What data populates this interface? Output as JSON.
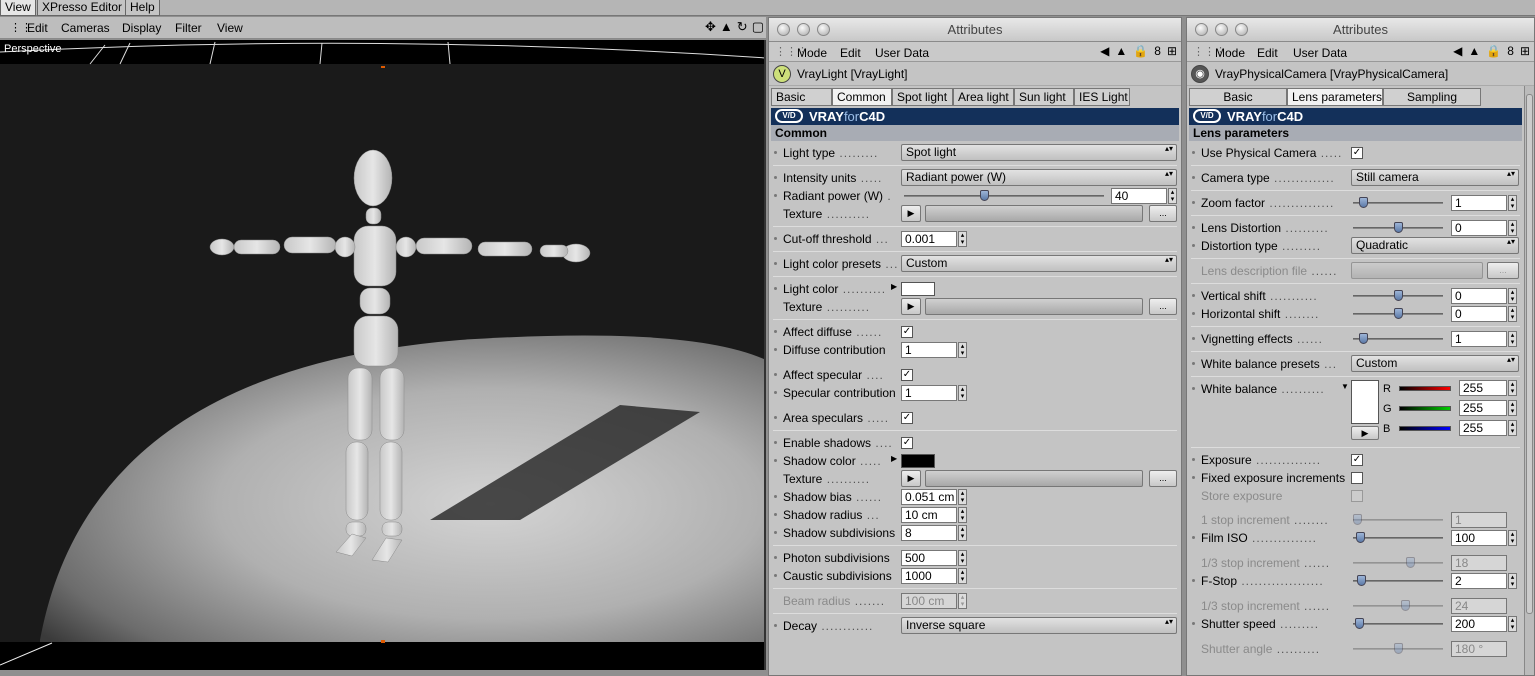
{
  "top_tabs": [
    "View",
    "XPresso Editor",
    "Help"
  ],
  "viewport": {
    "menu": [
      "Edit",
      "Cameras",
      "Display",
      "Filter",
      "View"
    ],
    "label": "Perspective",
    "icons": [
      "move-icon",
      "rotate-icon",
      "zoom-icon",
      "maximize-icon"
    ]
  },
  "panel1": {
    "title": "Attributes",
    "menu": [
      "Mode",
      "Edit",
      "User Data"
    ],
    "object": "VrayLight [VrayLight]",
    "tabs": [
      "Basic",
      "Common",
      "Spot light",
      "Area light",
      "Sun light",
      "IES Light"
    ],
    "active_tab": "Common",
    "brand_a": "VRAY",
    "brand_b": "for",
    "brand_c": "C4D",
    "section": "Common",
    "fields": {
      "light_type": {
        "label": "Light type",
        "value": "Spot light"
      },
      "intensity_units": {
        "label": "Intensity units",
        "value": "Radiant power (W)"
      },
      "radiant_power": {
        "label": "Radiant power (W)",
        "value": "40"
      },
      "texture1": {
        "label": "Texture"
      },
      "cutoff": {
        "label": "Cut-off threshold",
        "value": "0.001"
      },
      "color_presets": {
        "label": "Light color presets",
        "value": "Custom"
      },
      "light_color": {
        "label": "Light color"
      },
      "texture2": {
        "label": "Texture"
      },
      "affect_diffuse": {
        "label": "Affect diffuse"
      },
      "diffuse_contrib": {
        "label": "Diffuse contribution",
        "value": "1"
      },
      "affect_specular": {
        "label": "Affect specular"
      },
      "specular_contrib": {
        "label": "Specular contribution",
        "value": "1"
      },
      "area_speculars": {
        "label": "Area speculars"
      },
      "enable_shadows": {
        "label": "Enable shadows"
      },
      "shadow_color": {
        "label": "Shadow color"
      },
      "texture3": {
        "label": "Texture"
      },
      "shadow_bias": {
        "label": "Shadow bias",
        "value": "0.051 cm"
      },
      "shadow_radius": {
        "label": "Shadow radius",
        "value": "10 cm"
      },
      "shadow_subdiv": {
        "label": "Shadow subdivisions",
        "value": "8"
      },
      "photon_subdiv": {
        "label": "Photon subdivisions",
        "value": "500"
      },
      "caustic_subdiv": {
        "label": "Caustic subdivisions",
        "value": "1000"
      },
      "beam_radius": {
        "label": "Beam radius",
        "value": "100 cm"
      },
      "decay": {
        "label": "Decay",
        "value": "Inverse square"
      }
    },
    "more": "..."
  },
  "panel2": {
    "title": "Attributes",
    "menu": [
      "Mode",
      "Edit",
      "User Data"
    ],
    "object": "VrayPhysicalCamera [VrayPhysicalCamera]",
    "tabs": [
      "Basic",
      "Lens parameters",
      "Sampling"
    ],
    "active_tab": "Lens parameters",
    "section": "Lens parameters",
    "fields": {
      "use_physical": {
        "label": "Use Physical Camera"
      },
      "camera_type": {
        "label": "Camera type",
        "value": "Still camera"
      },
      "zoom_factor": {
        "label": "Zoom factor",
        "value": "1"
      },
      "lens_distortion": {
        "label": "Lens Distortion",
        "value": "0"
      },
      "distortion_type": {
        "label": "Distortion type",
        "value": "Quadratic"
      },
      "lens_desc": {
        "label": "Lens description file"
      },
      "vertical_shift": {
        "label": "Vertical shift",
        "value": "0"
      },
      "horizontal_shift": {
        "label": "Horizontal shift",
        "value": "0"
      },
      "vignetting": {
        "label": "Vignetting effects",
        "value": "1"
      },
      "wb_presets": {
        "label": "White balance presets",
        "value": "Custom"
      },
      "white_balance": {
        "label": "White balance",
        "r_label": "R",
        "g_label": "G",
        "b_label": "B",
        "r": "255",
        "g": "255",
        "b": "255"
      },
      "exposure": {
        "label": "Exposure"
      },
      "fixed_exposure": {
        "label": "Fixed exposure increments"
      },
      "store_exposure": {
        "label": "Store exposure"
      },
      "stop_increment": {
        "label": "1 stop increment",
        "value": "1"
      },
      "film_iso": {
        "label": "Film ISO",
        "value": "100"
      },
      "third_stop1": {
        "label": "1/3 stop increment",
        "value": "18"
      },
      "fstop": {
        "label": "F-Stop",
        "value": "2"
      },
      "third_stop2": {
        "label": "1/3 stop increment",
        "value": "24"
      },
      "shutter_speed": {
        "label": "Shutter speed",
        "value": "200"
      },
      "shutter_angle": {
        "label": "Shutter angle",
        "value": "180 °"
      }
    },
    "more": "..."
  },
  "checkmark": "✓",
  "colors": {
    "vray_bar": "#13305a",
    "active_tab": "#f2f2f2",
    "panel_bg": "#c4c4c4"
  }
}
